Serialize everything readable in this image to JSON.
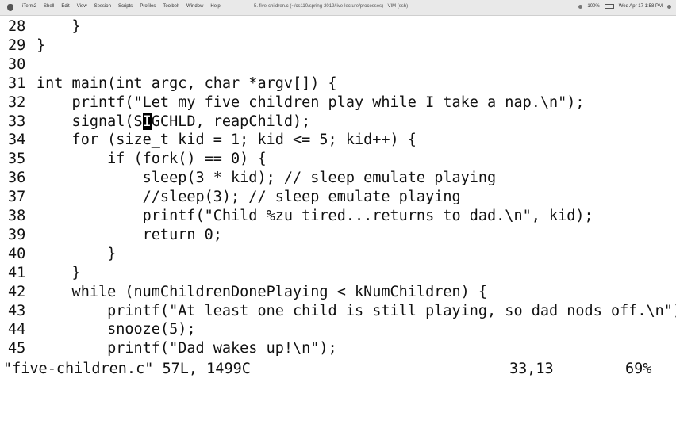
{
  "menubar": {
    "items": [
      "iTerm2",
      "Shell",
      "Edit",
      "View",
      "Session",
      "Scripts",
      "Profiles",
      "Toolbelt",
      "Window",
      "Help"
    ],
    "window_title": "5. five-children.c (~/cs110/spring-2019/live-lecture/processes) - VIM (ssh)",
    "clock": "Wed Apr 17  1:58 PM",
    "battery": "100%"
  },
  "editor": {
    "lines": [
      {
        "num": "28",
        "text": "    }"
      },
      {
        "num": "29",
        "text": "}"
      },
      {
        "num": "30",
        "text": ""
      },
      {
        "num": "31",
        "text": "int main(int argc, char *argv[]) {"
      },
      {
        "num": "32",
        "text": "    printf(\"Let my five children play while I take a nap.\\n\");"
      },
      {
        "num": "33",
        "text_before": "    signal(S",
        "cursor_char": "I",
        "text_after": "GCHLD, reapChild);"
      },
      {
        "num": "34",
        "text": "    for (size_t kid = 1; kid <= 5; kid++) {"
      },
      {
        "num": "35",
        "text": "        if (fork() == 0) {"
      },
      {
        "num": "36",
        "text": "            sleep(3 * kid); // sleep emulate playing"
      },
      {
        "num": "37",
        "text": "            //sleep(3); // sleep emulate playing"
      },
      {
        "num": "38",
        "text": "            printf(\"Child %zu tired...returns to dad.\\n\", kid);"
      },
      {
        "num": "39",
        "text": "            return 0;"
      },
      {
        "num": "40",
        "text": "        }"
      },
      {
        "num": "41",
        "text": "    }"
      },
      {
        "num": "42",
        "text": "    while (numChildrenDonePlaying < kNumChildren) {"
      },
      {
        "num": "43",
        "text": "        printf(\"At least one child is still playing, so dad nods off.\\n\");"
      },
      {
        "num": "44",
        "text": "        snooze(5);"
      },
      {
        "num": "45",
        "text": "        printf(\"Dad wakes up!\\n\");"
      }
    ]
  },
  "statusline": {
    "file_info": "\"five-children.c\" 57L, 1499C",
    "position": "33,13",
    "percent": "69%"
  }
}
